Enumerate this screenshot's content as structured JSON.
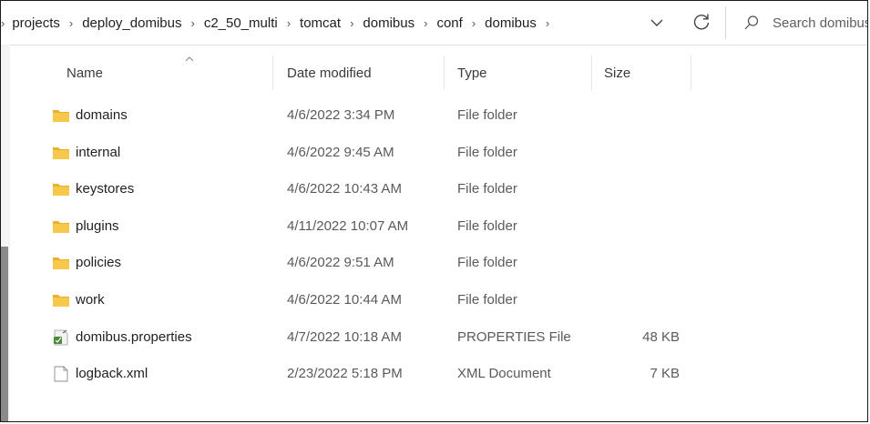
{
  "breadcrumb": [
    "projects",
    "deploy_domibus",
    "c2_50_multi",
    "tomcat",
    "domibus",
    "conf",
    "domibus"
  ],
  "search": {
    "placeholder": "Search domibus"
  },
  "columns": {
    "name": "Name",
    "date": "Date modified",
    "type": "Type",
    "size": "Size"
  },
  "sort": {
    "column": "name",
    "direction": "ascending"
  },
  "files": [
    {
      "name": "domains",
      "date": "4/6/2022 3:34 PM",
      "type": "File folder",
      "size": "",
      "icon": "folder-icon"
    },
    {
      "name": "internal",
      "date": "4/6/2022 9:45 AM",
      "type": "File folder",
      "size": "",
      "icon": "folder-icon"
    },
    {
      "name": "keystores",
      "date": "4/6/2022 10:43 AM",
      "type": "File folder",
      "size": "",
      "icon": "folder-icon"
    },
    {
      "name": "plugins",
      "date": "4/11/2022 10:07 AM",
      "type": "File folder",
      "size": "",
      "icon": "folder-icon"
    },
    {
      "name": "policies",
      "date": "4/6/2022 9:51 AM",
      "type": "File folder",
      "size": "",
      "icon": "folder-icon"
    },
    {
      "name": "work",
      "date": "4/6/2022 10:44 AM",
      "type": "File folder",
      "size": "",
      "icon": "folder-icon"
    },
    {
      "name": "domibus.properties",
      "date": "4/7/2022 10:18 AM",
      "type": "PROPERTIES File",
      "size": "48 KB",
      "icon": "properties-file-icon"
    },
    {
      "name": "logback.xml",
      "date": "2/23/2022 5:18 PM",
      "type": "XML Document",
      "size": "7 KB",
      "icon": "document-icon"
    }
  ],
  "colors": {
    "folder": "#f8c84a",
    "folder_tab": "#e8b030",
    "scrollbar_thumb": "#8a8a8a"
  }
}
